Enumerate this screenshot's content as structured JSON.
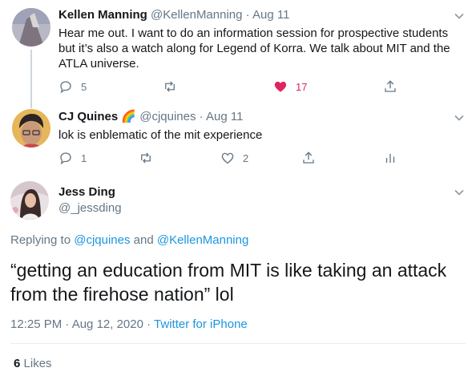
{
  "tweets": [
    {
      "name": "Kellen Manning",
      "handle": "@KellenManning",
      "date": "Aug 11",
      "text": "Hear me out. I want to do an information session for prospective students but it’s also a watch along for Legend of Korra. We talk about MIT and the ATLA universe.",
      "replies": "5",
      "likes": "17"
    },
    {
      "name": "CJ Quines",
      "name_emoji": "🌈",
      "handle": "@cjquines",
      "date": "Aug 11",
      "text": "lok is enblematic of the mit experience",
      "replies": "1",
      "likes": "2"
    }
  ],
  "main": {
    "name": "Jess Ding",
    "handle": "@_jessding",
    "replying_prefix": "Replying to",
    "reply_user1": "@cjquines",
    "reply_and": "and",
    "reply_user2": "@KellenManning",
    "text": "“getting an education from MIT is like taking an attack from the firehose nation” lol",
    "time": "12:25 PM · Aug 12, 2020",
    "meta_sep": "·",
    "client": "Twitter for iPhone",
    "likes_count": "6",
    "likes_label": "Likes"
  },
  "colors": {
    "link": "#1b95e0",
    "muted": "#657786",
    "like": "#e0245e",
    "thread": "#ccd6dd"
  }
}
